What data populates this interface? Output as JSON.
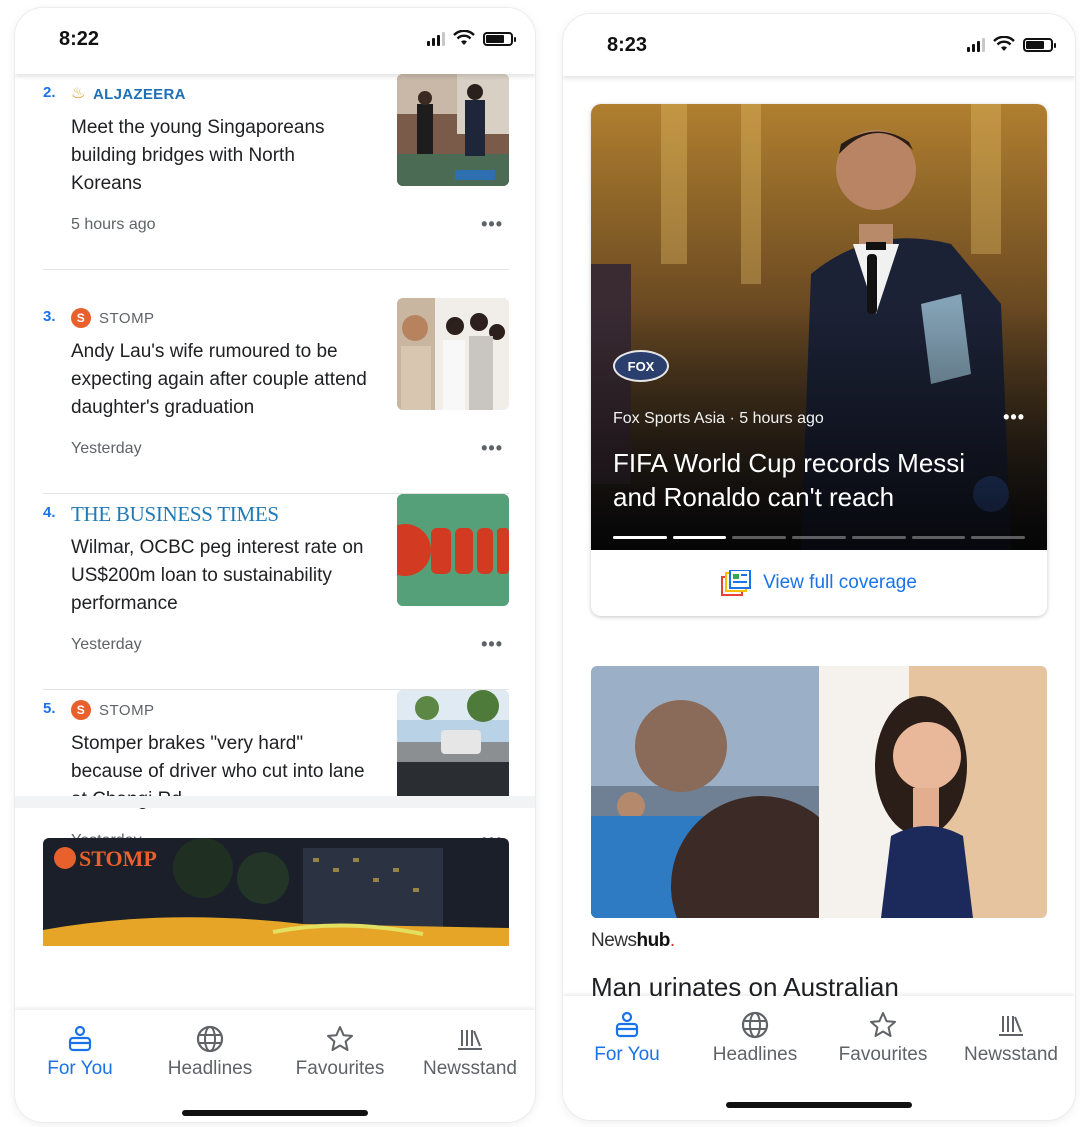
{
  "left_phone": {
    "status_time": "8:22",
    "articles": [
      {
        "rank": "2.",
        "source": "ALJAZEERA",
        "title": "Meet the young Singaporeans building bridges with North Koreans",
        "time": "5 hours ago"
      },
      {
        "rank": "3.",
        "source": "STOMP",
        "title": "Andy Lau's wife rumoured to be expecting again after couple attend daughter's graduation",
        "time": "Yesterday"
      },
      {
        "rank": "4.",
        "source": "THE BUSINESS TIMES",
        "title": "Wilmar, OCBC peg interest rate on US$200m loan to sustainability performance",
        "time": "Yesterday"
      },
      {
        "rank": "5.",
        "source": "STOMP",
        "title": "Stomper brakes \"very hard\" because of driver who cut into lane at Changi Rd",
        "time": "Yesterday"
      }
    ],
    "card_logo": "STOMP",
    "nav": [
      {
        "label": "For You",
        "active": true
      },
      {
        "label": "Headlines",
        "active": false
      },
      {
        "label": "Favourites",
        "active": false
      },
      {
        "label": "Newsstand",
        "active": false
      }
    ]
  },
  "right_phone": {
    "status_time": "8:23",
    "hero": {
      "logo": "FOX",
      "meta": "Fox Sports Asia · 5 hours ago",
      "title": "FIFA World Cup records Messi and Ronaldo can't reach",
      "coverage_label": "View full coverage"
    },
    "card2": {
      "source_a": "News",
      "source_b": "hub",
      "source_dot": ".",
      "title": "Man urinates on Australian"
    },
    "nav": [
      {
        "label": "For You",
        "active": true
      },
      {
        "label": "Headlines",
        "active": false
      },
      {
        "label": "Favourites",
        "active": false
      },
      {
        "label": "Newsstand",
        "active": false
      }
    ]
  },
  "colors": {
    "accent": "#1a73e8",
    "stomp": "#e8602c",
    "aljazeera": "#1f6fb5",
    "bt": "#1f7ab8"
  }
}
